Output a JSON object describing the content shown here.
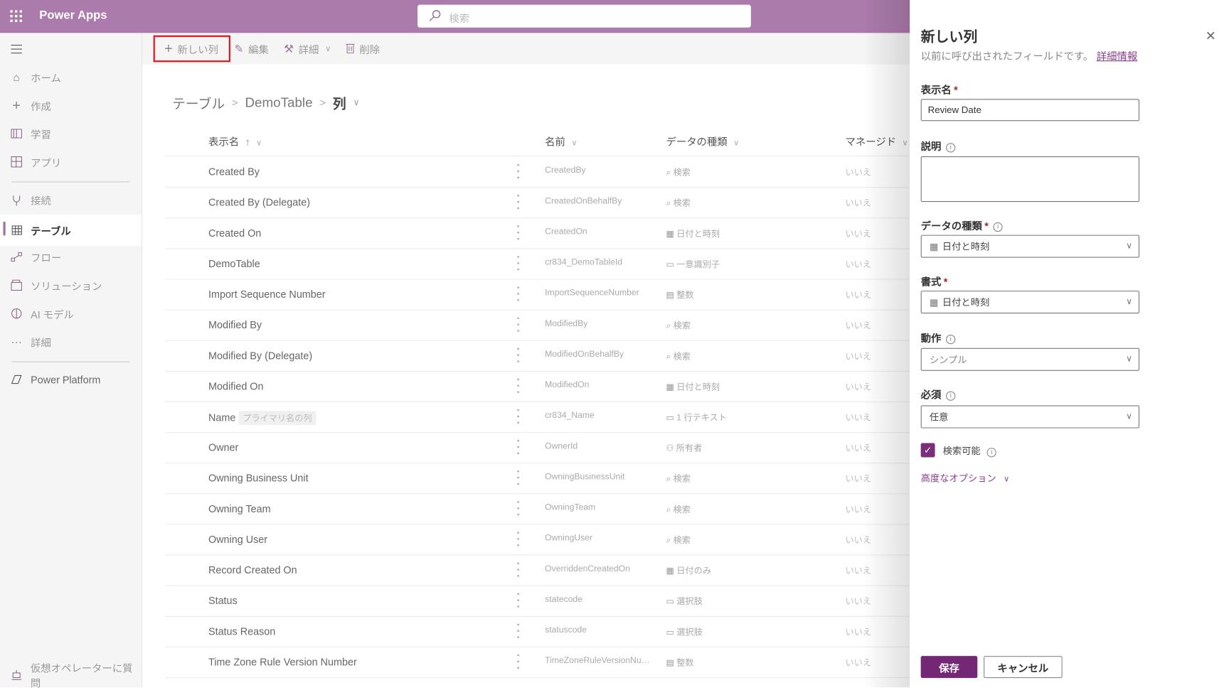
{
  "header": {
    "app_title": "Power Apps",
    "search_placeholder": "検索"
  },
  "sidebar": {
    "items": [
      {
        "label": "ホーム",
        "icon": "home-icon"
      },
      {
        "label": "作成",
        "icon": "plus-icon"
      },
      {
        "label": "学習",
        "icon": "book-icon"
      },
      {
        "label": "アプリ",
        "icon": "apps-icon"
      },
      {
        "label": "接続",
        "icon": "plug-icon"
      },
      {
        "label": "テーブル",
        "icon": "table-icon",
        "active": true
      },
      {
        "label": "フロー",
        "icon": "flow-icon"
      },
      {
        "label": "ソリューション",
        "icon": "solution-icon"
      },
      {
        "label": "AI モデル",
        "icon": "ai-brain-icon"
      },
      {
        "label": "詳細",
        "icon": "more-icon"
      },
      {
        "label": "Power Platform",
        "icon": "power-platform-icon"
      }
    ],
    "bot_label": "仮想オペレーターに質問"
  },
  "commandbar": {
    "new_column": "新しい列",
    "edit": "編集",
    "advanced": "詳細",
    "delete": "削除"
  },
  "breadcrumb": {
    "root": "テーブル",
    "table": "DemoTable",
    "current": "列"
  },
  "table": {
    "columns": [
      "表示名",
      "名前",
      "データの種類",
      "マネージド"
    ],
    "rows": [
      {
        "display": "Created By",
        "name": "CreatedBy",
        "type": "検索",
        "type_icon": "search",
        "managed": "いいえ"
      },
      {
        "display": "Created By (Delegate)",
        "name": "CreatedOnBehalfBy",
        "type": "検索",
        "type_icon": "search",
        "managed": "いいえ"
      },
      {
        "display": "Created On",
        "name": "CreatedOn",
        "type": "日付と時刻",
        "type_icon": "datetime",
        "managed": "いいえ"
      },
      {
        "display": "DemoTable",
        "name": "cr834_DemoTableId",
        "type": "一意識別子",
        "type_icon": "id",
        "managed": "いいえ"
      },
      {
        "display": "Import Sequence Number",
        "name": "ImportSequenceNumber",
        "type": "整数",
        "type_icon": "number",
        "managed": "いいえ"
      },
      {
        "display": "Modified By",
        "name": "ModifiedBy",
        "type": "検索",
        "type_icon": "search",
        "managed": "いいえ"
      },
      {
        "display": "Modified By (Delegate)",
        "name": "ModifiedOnBehalfBy",
        "type": "検索",
        "type_icon": "search",
        "managed": "いいえ"
      },
      {
        "display": "Modified On",
        "name": "ModifiedOn",
        "type": "日付と時刻",
        "type_icon": "datetime",
        "managed": "いいえ"
      },
      {
        "display": "Name",
        "badge": "プライマリ名の列",
        "name": "cr834_Name",
        "type": "1 行テキスト",
        "type_icon": "text",
        "managed": "いいえ"
      },
      {
        "display": "Owner",
        "name": "OwnerId",
        "type": "所有者",
        "type_icon": "person",
        "managed": "いいえ"
      },
      {
        "display": "Owning Business Unit",
        "name": "OwningBusinessUnit",
        "type": "検索",
        "type_icon": "search",
        "managed": "いいえ"
      },
      {
        "display": "Owning Team",
        "name": "OwningTeam",
        "type": "検索",
        "type_icon": "search",
        "managed": "いいえ"
      },
      {
        "display": "Owning User",
        "name": "OwningUser",
        "type": "検索",
        "type_icon": "search",
        "managed": "いいえ"
      },
      {
        "display": "Record Created On",
        "name": "OverriddenCreatedOn",
        "type": "日付のみ",
        "type_icon": "date",
        "managed": "いいえ"
      },
      {
        "display": "Status",
        "name": "statecode",
        "type": "選択肢",
        "type_icon": "choice",
        "managed": "いいえ"
      },
      {
        "display": "Status Reason",
        "name": "statuscode",
        "type": "選択肢",
        "type_icon": "choice",
        "managed": "いいえ"
      },
      {
        "display": "Time Zone Rule Version Number",
        "name": "TimeZoneRuleVersionNum...",
        "type": "整数",
        "type_icon": "number",
        "managed": "いいえ"
      }
    ]
  },
  "panel": {
    "title": "新しい列",
    "subtitle": "以前に呼び出されたフィールドです。",
    "learn_more": "詳細情報",
    "display_name_label": "表示名",
    "display_name_value": "Review Date",
    "description_label": "説明",
    "description_value": "",
    "data_type_label": "データの種類",
    "data_type_value": "日付と時刻",
    "format_label": "書式",
    "format_value": "日付と時刻",
    "behavior_label": "動作",
    "behavior_value": "シンプル",
    "required_label": "必須",
    "required_value": "任意",
    "searchable_label": "検索可能",
    "searchable_checked": true,
    "advanced_options": "高度なオプション",
    "save": "保存",
    "cancel": "キャンセル",
    "accent_color": "#742774"
  }
}
